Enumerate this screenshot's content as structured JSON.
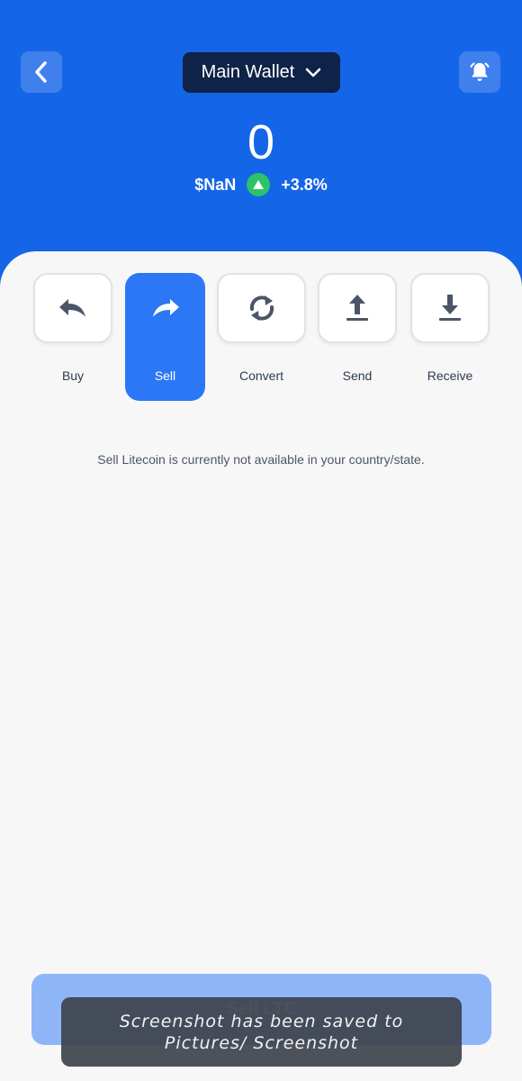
{
  "header": {
    "wallet_name": "Main Wallet",
    "balance": "0",
    "fiat_value": "$NaN",
    "change": "+3.8%",
    "accent_color": "#1565e8",
    "icons": {
      "back": "chevron-left-icon",
      "wallet_dropdown": "chevron-down-icon",
      "notifications": "bell-icon",
      "change": "triangle-up-icon"
    }
  },
  "actions": [
    {
      "label": "Buy",
      "icon": "reply-arrow-icon",
      "active": false
    },
    {
      "label": "Sell",
      "icon": "forward-arrow-icon",
      "active": true
    },
    {
      "label": "Convert",
      "icon": "convert-arrows-icon",
      "active": false
    },
    {
      "label": "Send",
      "icon": "upload-arrow-icon",
      "active": false
    },
    {
      "label": "Receive",
      "icon": "download-arrow-icon",
      "active": false
    }
  ],
  "notice": "Sell Litecoin is currently not available in your country/state.",
  "cta": {
    "label": "Sell LTC"
  },
  "toast": {
    "text": "Screenshot has been saved to Pictures/ Screenshot"
  }
}
